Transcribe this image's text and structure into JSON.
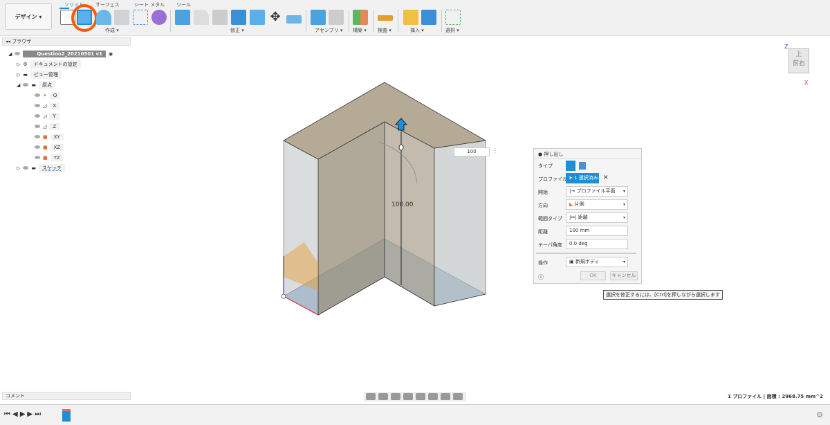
{
  "toolbar": {
    "design_label": "デザイン ▾",
    "tabs": [
      "ソリッド",
      "サーフェス",
      "シート メタル",
      "ツール"
    ],
    "groups": [
      "作成 ▾",
      "修正 ▾",
      "アセンブリ ▾",
      "構築 ▾",
      "検査 ▾",
      "挿入 ▾",
      "選択 ▾"
    ]
  },
  "browser": {
    "title": "ブラウザ",
    "root": "Question2_20210501 v1",
    "items": [
      "ドキュメントの設定",
      "ビュー管理",
      "原点",
      "O",
      "X",
      "Y",
      "Z",
      "XY",
      "XZ",
      "YZ",
      "スケッチ"
    ]
  },
  "viewport": {
    "dimension_label": "100.00",
    "dimension_input": "100",
    "viewcube": {
      "top": "上",
      "front": "前",
      "right": "右",
      "z": "Z",
      "x": "X"
    }
  },
  "extrude": {
    "title": "押し出し",
    "rows": [
      {
        "label": "タイプ"
      },
      {
        "label": "プロファイル",
        "value": "1 選択済み"
      },
      {
        "label": "開始",
        "value": "プロファイル平面"
      },
      {
        "label": "方向",
        "value": "片側"
      },
      {
        "label": "範囲タイプ",
        "value": "距離"
      },
      {
        "label": "距離",
        "value": "100 mm"
      },
      {
        "label": "テーパ角度",
        "value": "0.0 deg"
      },
      {
        "label": "操作",
        "value": "新規ボディ"
      }
    ],
    "ok": "OK",
    "cancel": "キャンセル"
  },
  "tooltip": "選択を修正するには、[Ctrl]を押しながら選択します",
  "comment": "コメント",
  "status": "1 プロファイル | 面積 : 2968.75 mm^2",
  "colors": {
    "accent": "#1e8fd5",
    "highlight": "#ff5a00"
  }
}
